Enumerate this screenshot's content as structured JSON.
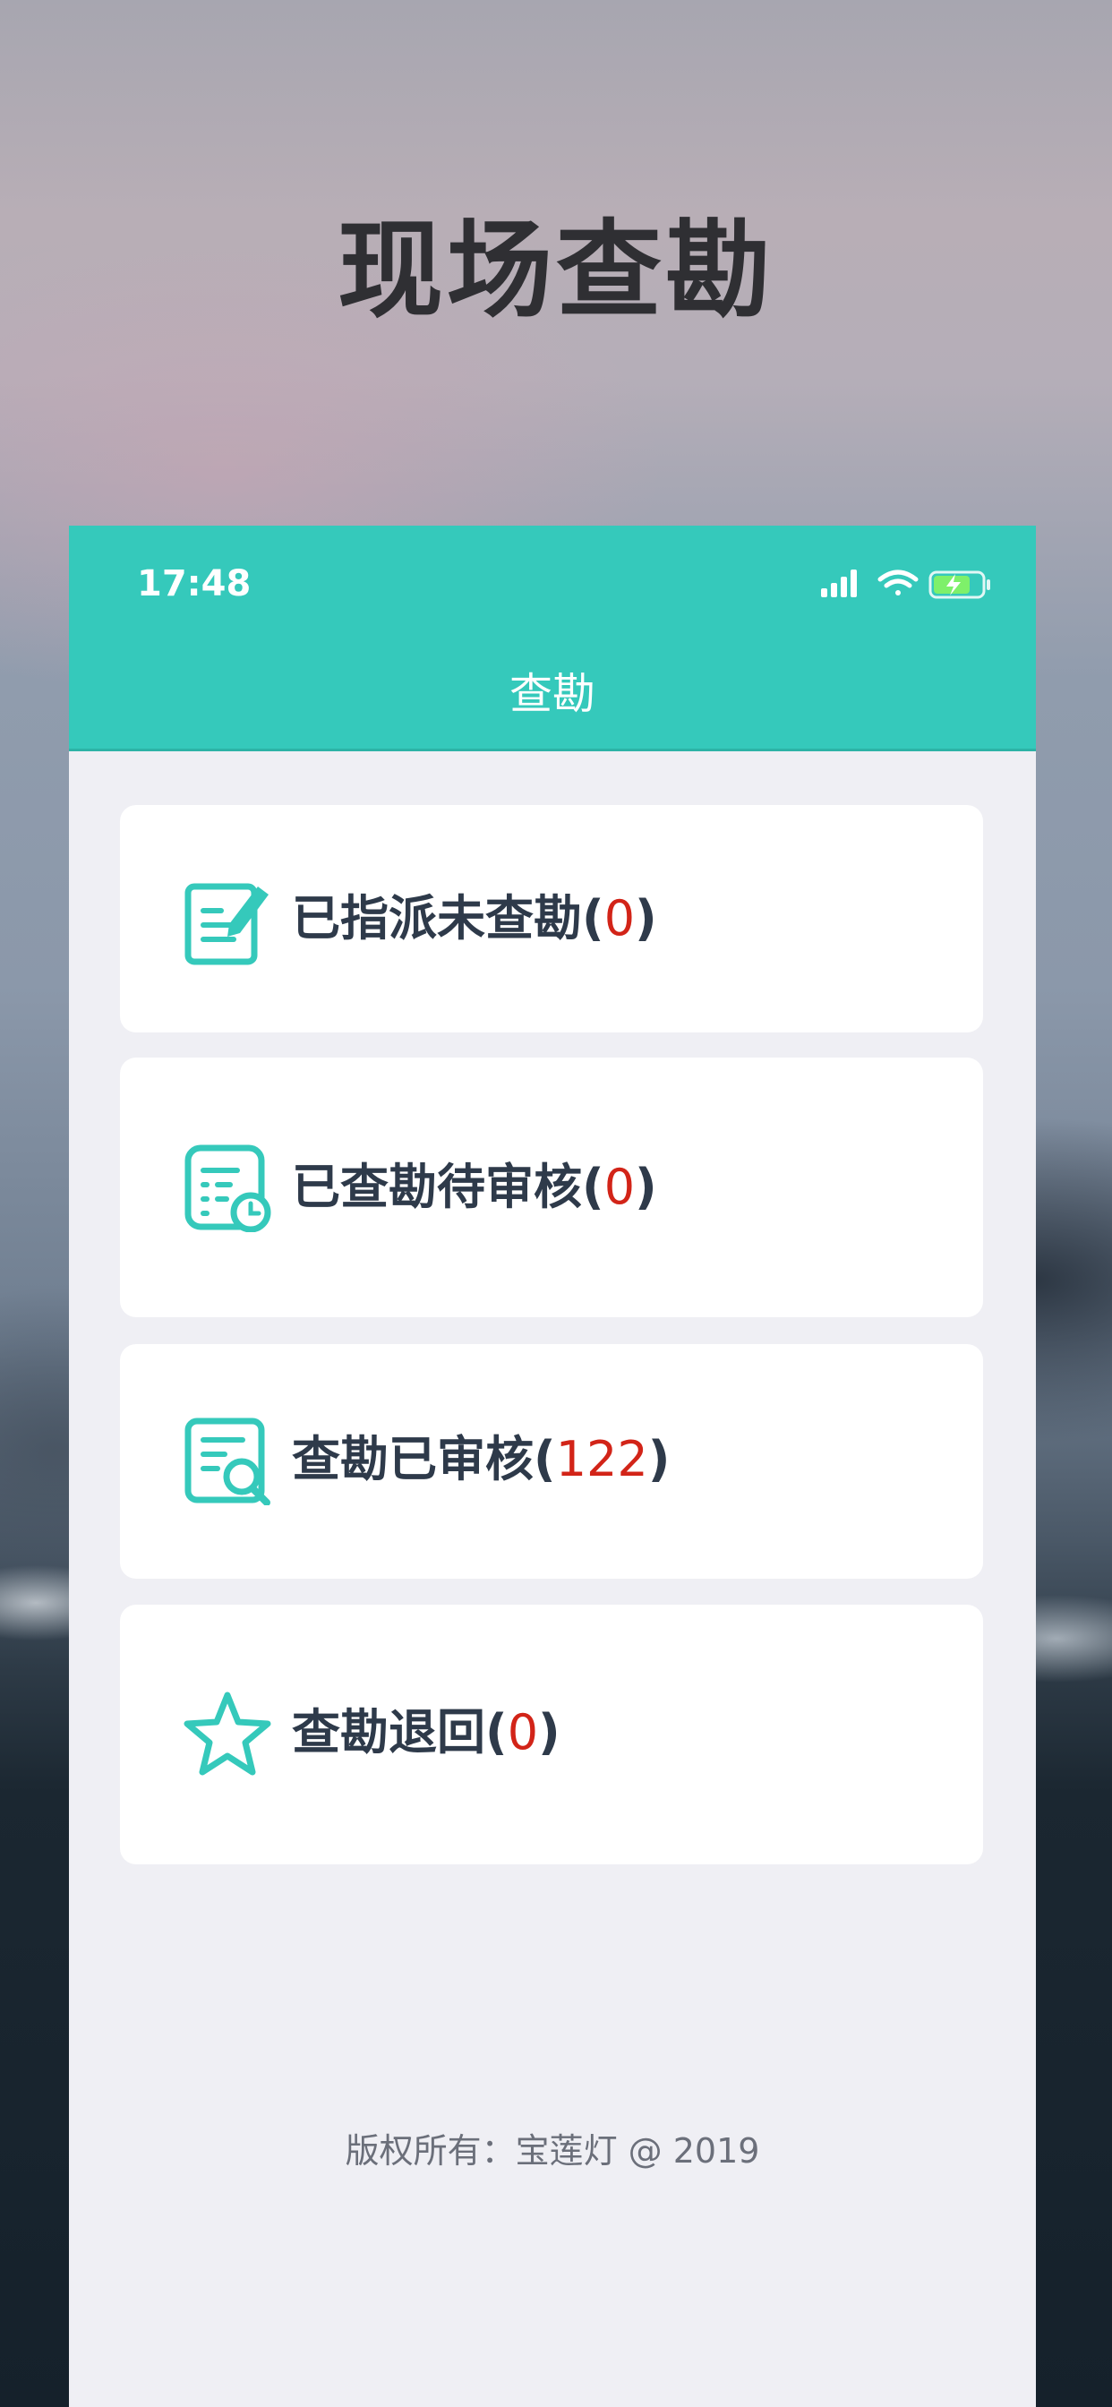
{
  "hero": {
    "title": "现场查勘"
  },
  "status_bar": {
    "time": "17:48"
  },
  "nav": {
    "title": "查勘"
  },
  "menu": [
    {
      "label": "已指派未查勘",
      "open": "(",
      "count": "0",
      "close": ")",
      "icon": "edit-document-icon"
    },
    {
      "label": "已查勘待审核",
      "open": "(",
      "count": "0",
      "close": ")",
      "icon": "document-clock-icon"
    },
    {
      "label": "查勘已审核",
      "open": "(",
      "count": "122",
      "close": ")",
      "icon": "document-search-icon"
    },
    {
      "label": "查勘退回",
      "open": "(",
      "count": "0",
      "close": ")",
      "icon": "star-icon"
    }
  ],
  "footer": {
    "text": "版权所有：宝莲灯 @ 2019"
  },
  "colors": {
    "accent": "#35c9bb",
    "count": "#d22418",
    "background": "#efeff4"
  }
}
